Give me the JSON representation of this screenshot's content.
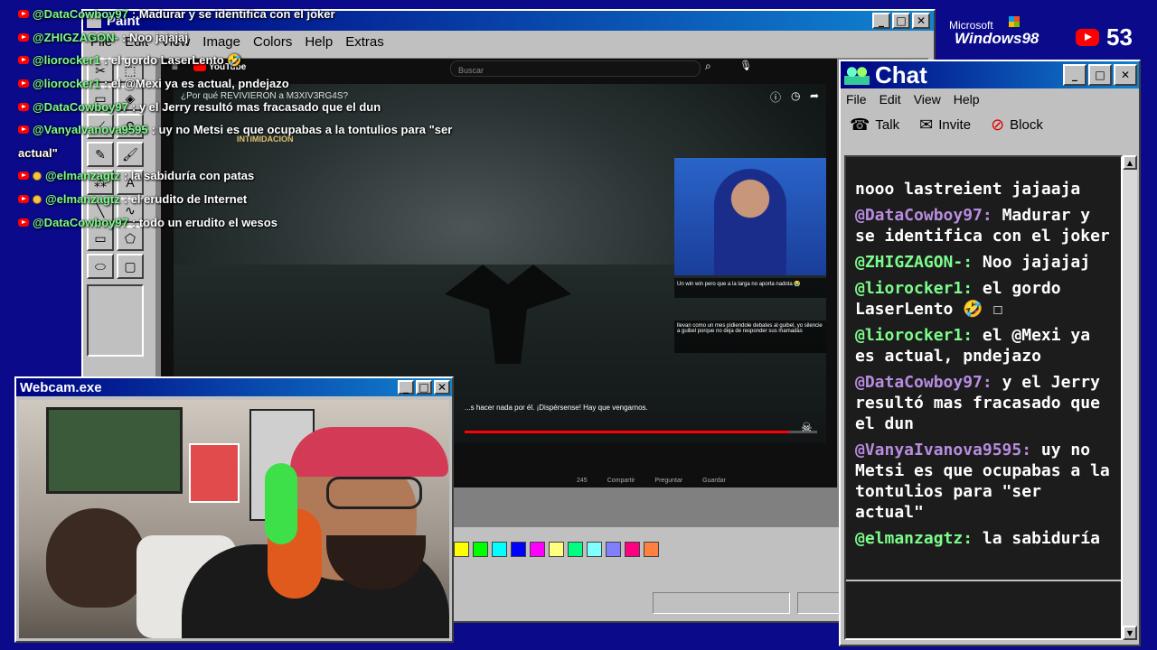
{
  "overlay_chat": [
    {
      "user": "@DataCowboy97",
      "user_color": "#7cfc8c",
      "text": ": Madurar y se identifica con el joker",
      "badges": [
        "youtube"
      ]
    },
    {
      "user": "@ZHIGZAGON-",
      "user_color": "#7cfc8c",
      "text": ": Noo jajajaj",
      "badges": [
        "youtube"
      ]
    },
    {
      "user": "@liorocker1",
      "user_color": "#7cfc8c",
      "text": ": el gordo LaserLento 🤣",
      "badges": [
        "youtube"
      ]
    },
    {
      "user": "@liorocker1",
      "user_color": "#7cfc8c",
      "text": ": el @Mexi ya es actual, pndejazo",
      "badges": [
        "youtube"
      ]
    },
    {
      "user": "@DataCowboy97",
      "user_color": "#7cfc8c",
      "text": ": y el Jerry resultó mas fracasado que el dun",
      "badges": [
        "youtube"
      ]
    },
    {
      "user": "@VanyaIvanova9595",
      "user_color": "#7cfc8c",
      "text": ": uy no Metsi es que ocupabas a la tontulios para \"ser",
      "badges": [
        "youtube"
      ]
    },
    {
      "user": "",
      "user_color": "#ffffff",
      "text": "actual\"",
      "badges": []
    },
    {
      "user": "@elmanzagtz",
      "user_color": "#7cfc8c",
      "text": ": la sabiduría con patas",
      "badges": [
        "youtube",
        "member"
      ]
    },
    {
      "user": "@elmanzagtz",
      "user_color": "#7cfc8c",
      "text": ": el erudito de Internet",
      "badges": [
        "youtube",
        "member"
      ]
    },
    {
      "user": "@DataCowboy97",
      "user_color": "#7cfc8c",
      "text": ": todo un erudito el wesos",
      "badges": [
        "youtube"
      ]
    }
  ],
  "paint": {
    "title": "Paint",
    "menu": [
      "File",
      "Edit",
      "View",
      "Image",
      "Colors",
      "Help",
      "Extras"
    ],
    "palette": [
      "#ffff00",
      "#00ff00",
      "#00ffff",
      "#0000ff",
      "#ff00ff",
      "#ffff80",
      "#00ff80",
      "#80ffff",
      "#8080ff",
      "#ff0080",
      "#ff8040"
    ]
  },
  "youtube": {
    "brand": "YouTube",
    "search_placeholder": "Buscar",
    "video_title": "¿Por qué REVIVIERON a M3XIV3RG4S?",
    "game_label": "INTIMIDACIÓN",
    "subtitle": "...s hacer nada por él. ¡Dispérsense! Hay que vengarnos.",
    "cam_comment_1": "Un win win pero que a la larga no aporta nadota 😭",
    "cam_comment_2": "llevan como un mes pidiendole debates al guibel, yo silencie a guibel porque no deja de responder sus mamadas",
    "actions": [
      "245",
      "Compartir",
      "Preguntar",
      "Guardar"
    ]
  },
  "win98_logo": {
    "microsoft": "Microsoft",
    "windows": "Windows98"
  },
  "viewers": {
    "count": "53"
  },
  "webcam": {
    "title": "Webcam.exe"
  },
  "chat_window": {
    "title": "Chat",
    "menu": [
      "File",
      "Edit",
      "View",
      "Help"
    ],
    "toolbar": [
      "Talk",
      "Invite",
      "Block"
    ],
    "messages": [
      {
        "user": "",
        "user_color": "#ffffff",
        "text": "nooo lastreient jajaaja"
      },
      {
        "user": "@DataCowboy97:",
        "user_color": "#b88ce0",
        "text": "Madurar y se identifica con el joker"
      },
      {
        "user": "@ZHIGZAGON-:",
        "user_color": "#7cfc8c",
        "text": "Noo jajajaj"
      },
      {
        "user": "@liorocker1:",
        "user_color": "#7cfc8c",
        "text": "el gordo LaserLento 🤣 ☐"
      },
      {
        "user": "@liorocker1:",
        "user_color": "#7cfc8c",
        "text": "el @Mexi ya es actual, pndejazo"
      },
      {
        "user": "@DataCowboy97:",
        "user_color": "#b88ce0",
        "text": "y el Jerry resultó mas fracasado que el dun"
      },
      {
        "user": "@VanyaIvanova9595:",
        "user_color": "#b88ce0",
        "text": "uy no Metsi es que ocupabas a la tontulios para \"ser actual\""
      },
      {
        "user": "@elmanzagtz:",
        "user_color": "#7cfc8c",
        "text": "la sabiduría"
      }
    ]
  }
}
